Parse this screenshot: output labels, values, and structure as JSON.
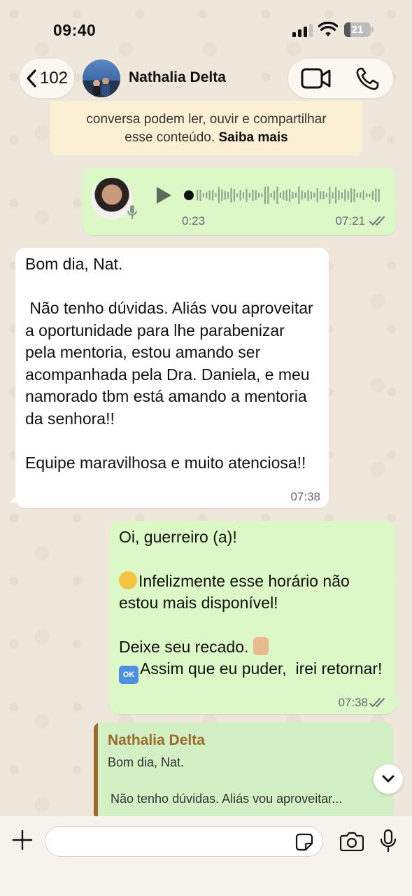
{
  "status_bar": {
    "time": "09:40",
    "battery": "21"
  },
  "header": {
    "back_count": "102",
    "contact_name": "Nathalia Delta"
  },
  "notice": {
    "line1": "conversa podem ler, ouvir e compartilhar",
    "line2": "esse conteúdo.",
    "link": "Saiba mais"
  },
  "voice_message": {
    "duration": "0:23",
    "time": "07:21"
  },
  "incoming_message": {
    "text": "Bom dia, Nat.\n\n Não tenho dúvidas. Aliás vou aproveitar a oportunidade para lhe parabenizar pela mentoria, estou amando ser acompanhada pela Dra. Daniela, e meu namorado tbm está amando a mentoria da senhora!!\n\nEquipe maravilhosa e muito atenciosa!!",
    "time": "07:38"
  },
  "auto_reply": {
    "line1": "Oi, guerreiro (a)!",
    "line2": "Infelizmente esse horário não estou mais disponível!",
    "line3": "Deixe seu recado. ",
    "line4": "Assim que eu puder,  irei retornar!",
    "time": "07:38"
  },
  "reply_preview": {
    "name": "Nathalia Delta",
    "line1": "Bom dia, Nat.",
    "line2": "Não tenho dúvidas. Aliás vou aproveitar..."
  },
  "input": {
    "placeholder": ""
  },
  "colors": {
    "outgoing": "#dcf8c6",
    "incoming": "#ffffff",
    "reply_accent": "#9c6a2c",
    "notice_bg": "#fbf0d3"
  }
}
